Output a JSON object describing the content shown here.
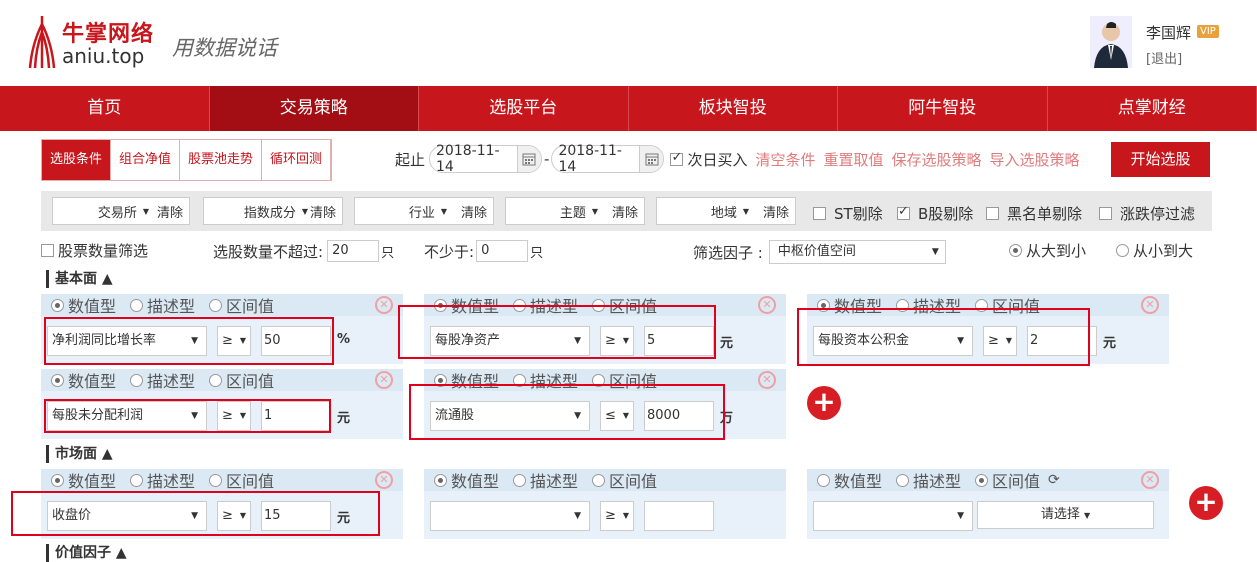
{
  "header": {
    "brand_cn": "牛掌网络",
    "brand_en": "aniu.top",
    "slogan": "用数据说话",
    "user_name": "李国辉",
    "vip_badge": "VIP",
    "logout_label": "[退出]"
  },
  "nav": {
    "items": [
      "首页",
      "交易策略",
      "选股平台",
      "板块智投",
      "阿牛智投",
      "点掌财经"
    ],
    "active_index": 1
  },
  "tabs": [
    "选股条件",
    "组合净值",
    "股票池走势",
    "循环回测"
  ],
  "date_bar": {
    "start_label": "起止",
    "start_date": "2018-11-14",
    "separator": "-",
    "end_date": "2018-11-14",
    "next_day_label": "次日买入",
    "next_day_checked": true,
    "links": [
      "清空条件",
      "重置取值",
      "保存选股策略",
      "导入选股策略"
    ],
    "start_button": "开始选股"
  },
  "filter_bar": {
    "exchange": "交易所",
    "index": "指数成分",
    "industry": "行业",
    "theme": "主题",
    "region": "地域",
    "clear": "清除",
    "st_remove": "ST剔除",
    "st_checked": false,
    "b_remove": "B股剔除",
    "b_checked": true,
    "blacklist": "黑名单剔除",
    "blacklist_checked": false,
    "limit_filter": "涨跌停过滤",
    "limit_checked": false
  },
  "count_row": {
    "count_filter_label": "股票数量筛选",
    "max_label": "选股数量不超过:",
    "max_value": "20",
    "unit": "只",
    "min_label": "不少于:",
    "min_value": "0",
    "factor_label": "筛选因子 :",
    "factor_value": "中枢价值空间",
    "desc_label": "从大到小",
    "asc_label": "从小到大"
  },
  "radio_labels": {
    "numeric": "数值型",
    "descriptive": "描述型",
    "range": "区间值"
  },
  "sections": {
    "fundamental": "基本面 ▲",
    "market": "市场面 ▲",
    "value": "价值因子 ▲"
  },
  "fundamental_cards": [
    {
      "field": "净利润同比增长率",
      "op": "≥",
      "value": "50",
      "unit": "%"
    },
    {
      "field": "每股净资产",
      "op": "≥",
      "value": "5",
      "unit": "元"
    },
    {
      "field": "每股资本公积金",
      "op": "≥",
      "value": "2",
      "unit": "元"
    },
    {
      "field": "每股未分配利润",
      "op": "≥",
      "value": "1",
      "unit": "元"
    },
    {
      "field": "流通股",
      "op": "≤",
      "value": "8000",
      "unit": "万"
    }
  ],
  "market_cards": [
    {
      "field": "收盘价",
      "op": "≥",
      "value": "15",
      "unit": "元"
    },
    {
      "field": "",
      "op": "≥",
      "value": "",
      "unit": ""
    }
  ],
  "range_card": {
    "pick_label": "请选择"
  },
  "icons": {
    "add": "+",
    "close": "✕",
    "refresh": "⟳"
  }
}
